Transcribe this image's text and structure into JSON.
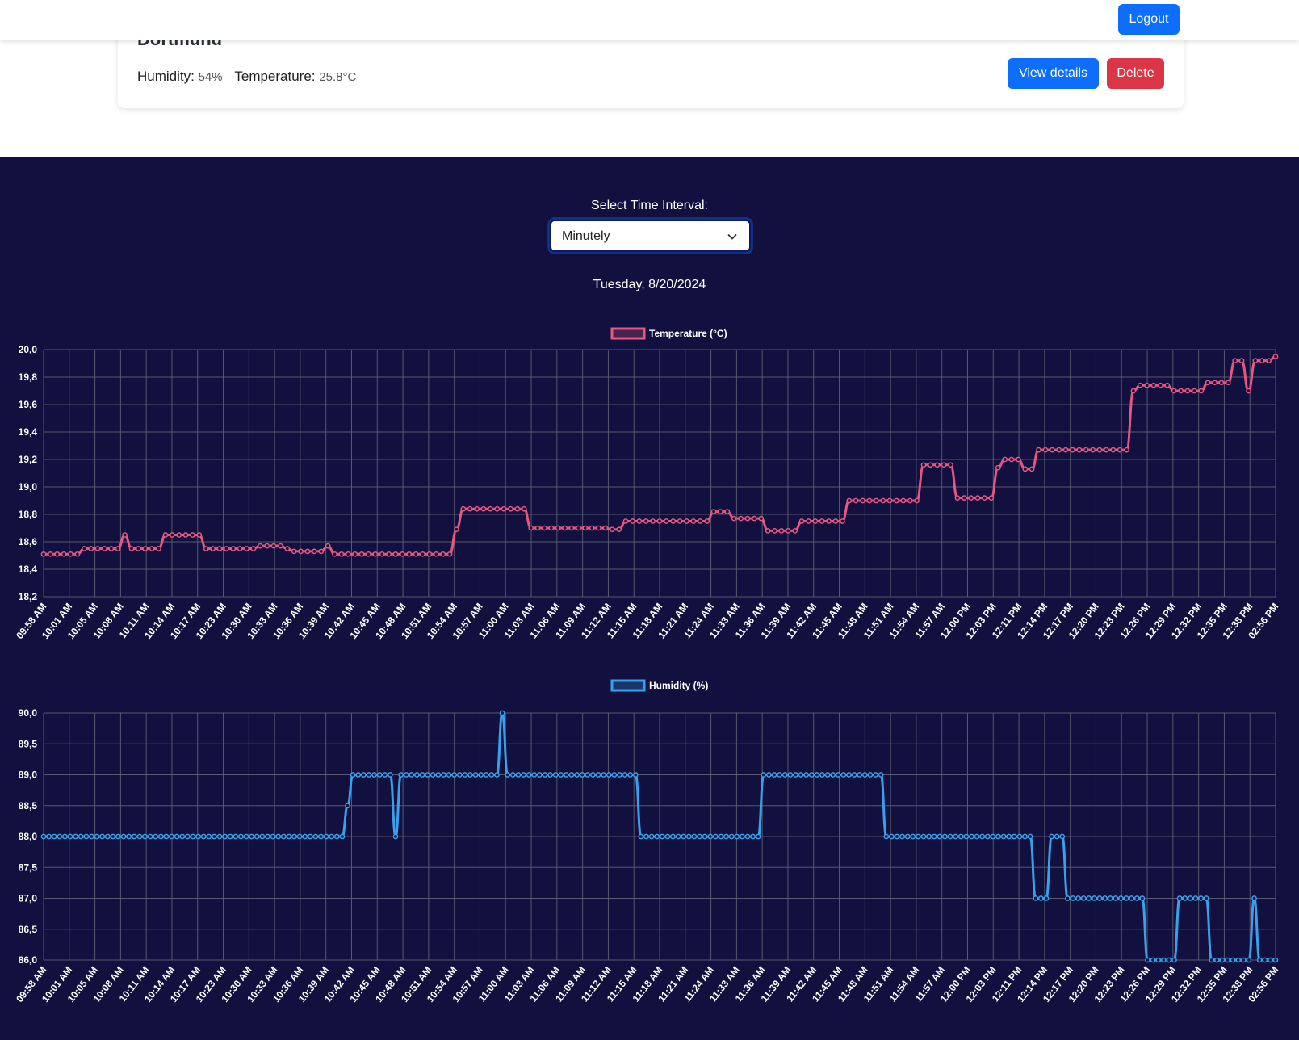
{
  "header": {
    "logout_label": "Logout"
  },
  "station": {
    "name": "Dortmund",
    "humidity_label": "Humidity:",
    "humidity_value": "54%",
    "temperature_label": "Temperature:",
    "temperature_value": "25.8°C",
    "view_label": "View details",
    "delete_label": "Delete"
  },
  "controls": {
    "interval_label": "Select Time Interval:",
    "interval_value": "Minutely",
    "date": "Tuesday, 8/20/2024"
  },
  "colors": {
    "temperature": "#e8577f",
    "humidity": "#36a2eb"
  },
  "chart_data": [
    {
      "type": "line",
      "legend": "Temperature (°C)",
      "legend_position": "top-center",
      "grid": true,
      "ylim": [
        18.2,
        20.0
      ],
      "y_ticks": [
        "18,2",
        "18,4",
        "18,6",
        "18,8",
        "19,0",
        "19,2",
        "19,4",
        "19,6",
        "19,8",
        "20,0"
      ],
      "x_tick_labels": [
        "09:58 AM",
        "10:01 AM",
        "10:05 AM",
        "10:08 AM",
        "10:11 AM",
        "10:14 AM",
        "10:17 AM",
        "10:23 AM",
        "10:30 AM",
        "10:33 AM",
        "10:36 AM",
        "10:39 AM",
        "10:42 AM",
        "10:45 AM",
        "10:48 AM",
        "10:51 AM",
        "10:54 AM",
        "10:57 AM",
        "11:00 AM",
        "11:03 AM",
        "11:06 AM",
        "11:09 AM",
        "11:12 AM",
        "11:15 AM",
        "11:18 AM",
        "11:21 AM",
        "11:24 AM",
        "11:33 AM",
        "11:36 AM",
        "11:39 AM",
        "11:42 AM",
        "11:45 AM",
        "11:48 AM",
        "11:51 AM",
        "11:54 AM",
        "11:57 AM",
        "12:00 PM",
        "12:03 PM",
        "12:11 PM",
        "12:14 PM",
        "12:17 PM",
        "12:20 PM",
        "12:23 PM",
        "12:26 PM",
        "12:29 PM",
        "12:32 PM",
        "12:35 PM",
        "12:38 PM",
        "02:56 PM"
      ],
      "values": [
        18.51,
        18.51,
        18.51,
        18.51,
        18.51,
        18.51,
        18.55,
        18.55,
        18.55,
        18.55,
        18.55,
        18.55,
        18.65,
        18.55,
        18.55,
        18.55,
        18.55,
        18.55,
        18.65,
        18.65,
        18.65,
        18.65,
        18.65,
        18.65,
        18.55,
        18.55,
        18.55,
        18.55,
        18.55,
        18.55,
        18.55,
        18.55,
        18.57,
        18.57,
        18.57,
        18.57,
        18.55,
        18.53,
        18.53,
        18.53,
        18.53,
        18.53,
        18.57,
        18.51,
        18.51,
        18.51,
        18.51,
        18.51,
        18.51,
        18.51,
        18.51,
        18.51,
        18.51,
        18.51,
        18.51,
        18.51,
        18.51,
        18.51,
        18.51,
        18.51,
        18.51,
        18.69,
        18.84,
        18.84,
        18.84,
        18.84,
        18.84,
        18.84,
        18.84,
        18.84,
        18.84,
        18.84,
        18.7,
        18.7,
        18.7,
        18.7,
        18.7,
        18.7,
        18.7,
        18.7,
        18.7,
        18.7,
        18.7,
        18.7,
        18.69,
        18.69,
        18.75,
        18.75,
        18.75,
        18.75,
        18.75,
        18.75,
        18.75,
        18.75,
        18.75,
        18.75,
        18.75,
        18.75,
        18.75,
        18.82,
        18.82,
        18.82,
        18.77,
        18.77,
        18.77,
        18.77,
        18.77,
        18.68,
        18.68,
        18.68,
        18.68,
        18.68,
        18.75,
        18.75,
        18.75,
        18.75,
        18.75,
        18.75,
        18.75,
        18.9,
        18.9,
        18.9,
        18.9,
        18.9,
        18.9,
        18.9,
        18.9,
        18.9,
        18.9,
        18.9,
        19.16,
        19.16,
        19.16,
        19.16,
        19.16,
        18.92,
        18.92,
        18.92,
        18.92,
        18.92,
        18.92,
        19.14,
        19.2,
        19.2,
        19.2,
        19.13,
        19.13,
        19.27,
        19.27,
        19.27,
        19.27,
        19.27,
        19.27,
        19.27,
        19.27,
        19.27,
        19.27,
        19.27,
        19.27,
        19.27,
        19.27,
        19.7,
        19.74,
        19.74,
        19.74,
        19.74,
        19.74,
        19.7,
        19.7,
        19.7,
        19.7,
        19.7,
        19.76,
        19.76,
        19.76,
        19.76,
        19.92,
        19.92,
        19.7,
        19.92,
        19.92,
        19.92,
        19.95
      ]
    },
    {
      "type": "line",
      "legend": "Humidity (%)",
      "legend_position": "top-center",
      "grid": true,
      "ylim": [
        86.0,
        90.0
      ],
      "y_ticks": [
        "86,0",
        "86,5",
        "87,0",
        "87,5",
        "88,0",
        "88,5",
        "89,0",
        "89,5",
        "90,0"
      ],
      "x_tick_labels": [
        "09:58 AM",
        "10:01 AM",
        "10:05 AM",
        "10:08 AM",
        "10:11 AM",
        "10:14 AM",
        "10:17 AM",
        "10:23 AM",
        "10:30 AM",
        "10:33 AM",
        "10:36 AM",
        "10:39 AM",
        "10:42 AM",
        "10:45 AM",
        "10:48 AM",
        "10:51 AM",
        "10:54 AM",
        "10:57 AM",
        "11:00 AM",
        "11:03 AM",
        "11:06 AM",
        "11:09 AM",
        "11:12 AM",
        "11:15 AM",
        "11:18 AM",
        "11:21 AM",
        "11:24 AM",
        "11:33 AM",
        "11:36 AM",
        "11:39 AM",
        "11:42 AM",
        "11:45 AM",
        "11:48 AM",
        "11:51 AM",
        "11:54 AM",
        "11:57 AM",
        "12:00 PM",
        "12:03 PM",
        "12:11 PM",
        "12:14 PM",
        "12:17 PM",
        "12:20 PM",
        "12:23 PM",
        "12:26 PM",
        "12:29 PM",
        "12:32 PM",
        "12:35 PM",
        "12:38 PM",
        "02:56 PM"
      ],
      "values": [
        88,
        88,
        88,
        88,
        88,
        88,
        88,
        88,
        88,
        88,
        88,
        88,
        88,
        88,
        88,
        88,
        88,
        88,
        88,
        88,
        88,
        88,
        88,
        88,
        88,
        88,
        88,
        88,
        88,
        88,
        88,
        88,
        88,
        88,
        88,
        88,
        88,
        88,
        88,
        88,
        88,
        88,
        88,
        88,
        88,
        88,
        88,
        88,
        88,
        88,
        88,
        88,
        88,
        88,
        88,
        88,
        88,
        88.5,
        89,
        89,
        89,
        89,
        89,
        89,
        89,
        89,
        88,
        89,
        89,
        89,
        89,
        89,
        89,
        89,
        89,
        89,
        89,
        89,
        89,
        89,
        89,
        89,
        89,
        89,
        89,
        89,
        90,
        89,
        89,
        89,
        89,
        89,
        89,
        89,
        89,
        89,
        89,
        89,
        89,
        89,
        89,
        89,
        89,
        89,
        89,
        89,
        89,
        89,
        89,
        89,
        89,
        89,
        88,
        88,
        88,
        88,
        88,
        88,
        88,
        88,
        88,
        88,
        88,
        88,
        88,
        88,
        88,
        88,
        88,
        88,
        88,
        88,
        88,
        88,
        88,
        89,
        89,
        89,
        89,
        89,
        89,
        89,
        89,
        89,
        89,
        89,
        89,
        89,
        89,
        89,
        89,
        89,
        89,
        89,
        89,
        89,
        89,
        89,
        88,
        88,
        88,
        88,
        88,
        88,
        88,
        88,
        88,
        88,
        88,
        88,
        88,
        88,
        88,
        88,
        88,
        88,
        88,
        88,
        88,
        88,
        88,
        88,
        88,
        88,
        88,
        88,
        87,
        87,
        87,
        88,
        88,
        88,
        87,
        87,
        87,
        87,
        87,
        87,
        87,
        87,
        87,
        87,
        87,
        87,
        87,
        87,
        87,
        86,
        86,
        86,
        86,
        86,
        86,
        87,
        87,
        87,
        87,
        87,
        87,
        86,
        86,
        86,
        86,
        86,
        86,
        86,
        86,
        87,
        86,
        86,
        86,
        86
      ]
    }
  ]
}
